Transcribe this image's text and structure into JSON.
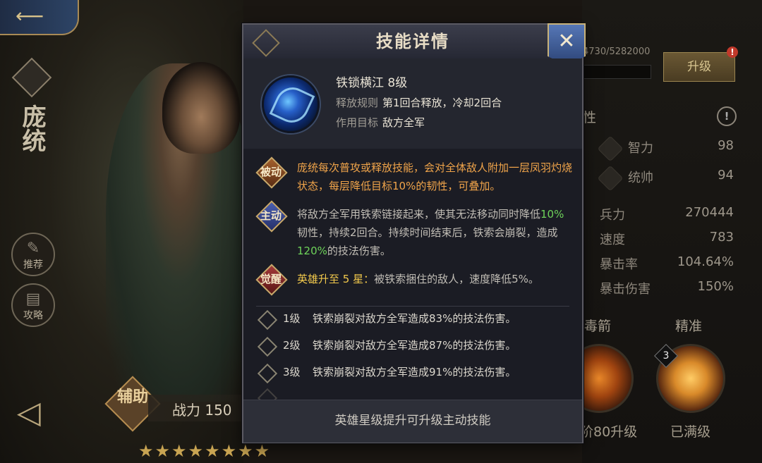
{
  "hero": {
    "name": "庞统",
    "role": "辅助",
    "power_label": "战力 150",
    "stars": "★★★★★★★★",
    "side_buttons": [
      {
        "label": "推荐",
        "icon": "scroll-icon"
      },
      {
        "label": "攻略",
        "icon": "book-icon"
      }
    ]
  },
  "right_panel": {
    "exp_text": "4730/5282000",
    "upgrade_label": "升级",
    "alert_badge": "!",
    "attributes_heading": "性",
    "info_badge": "!",
    "attrs_icon": [
      {
        "label": "智力",
        "value": "98"
      },
      {
        "label": "统帅",
        "value": "94"
      }
    ],
    "attrs": [
      {
        "label": "兵力",
        "value": "270444"
      },
      {
        "label": "速度",
        "value": "783"
      },
      {
        "label": "暴击率",
        "value": "104.64%"
      },
      {
        "label": "暴击伤害",
        "value": "150%"
      }
    ],
    "skill_columns": [
      {
        "label": "毒箭",
        "note": "阶80升级"
      },
      {
        "label": "精准",
        "note": "已满级",
        "level": "3"
      }
    ]
  },
  "modal": {
    "title": "技能详情",
    "close_icon": "close-icon",
    "skill": {
      "name": "铁锁横江  8级",
      "release_label": "释放规则",
      "release_value": "第1回合释放，冷却2回合",
      "target_label": "作用目标",
      "target_value": "敌方全军"
    },
    "passive": {
      "tag": "被动",
      "text": "庞统每次普攻或释放技能，会对全体敌人附加一层凤羽灼烧状态，每层降低目标10%的韧性，可叠加。"
    },
    "active": {
      "tag": "主动",
      "text_1": "将敌方全军用铁索链接起来，使其无法移动同时降低",
      "pct_1": "10%",
      "text_2": "韧性，持续2回合。持续时间结束后，铁索会崩裂，造成",
      "pct_2": "120%",
      "text_3": "的技法伤害。"
    },
    "awaken": {
      "tag": "觉醒",
      "highlight": "英雄升至 5 星：",
      "text": "被铁索捆住的敌人，速度降低5%。"
    },
    "levels": [
      {
        "level": "1级",
        "desc": "铁索崩裂对敌方全军造成83%的技法伤害。"
      },
      {
        "level": "2级",
        "desc": "铁索崩裂对敌方全军造成87%的技法伤害。"
      },
      {
        "level": "3级",
        "desc": "铁索崩裂对敌方全军造成91%的技法伤害。"
      }
    ],
    "footer": "英雄星级提升可升级主动技能"
  },
  "colors": {
    "passive_text": "#f0a44a",
    "highlight_green": "#6ed35a",
    "awaken_yellow": "#f2c94c",
    "close_blue": "#5677b6"
  }
}
